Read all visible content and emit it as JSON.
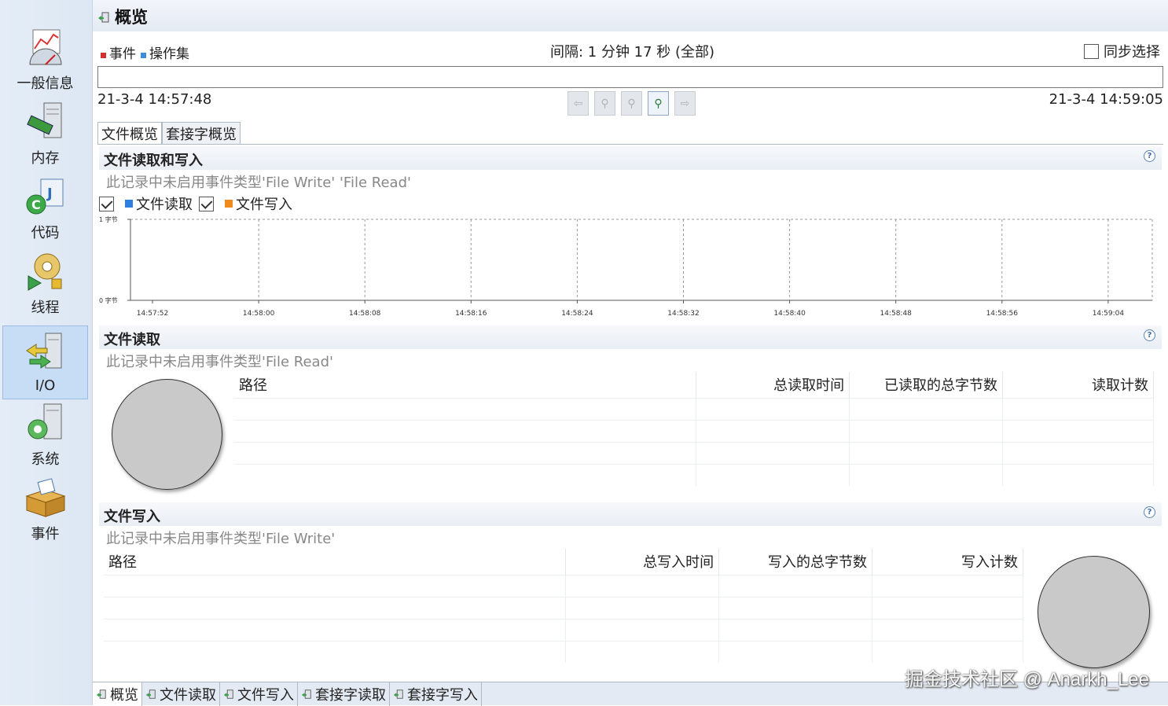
{
  "sidebar": {
    "items": [
      {
        "label": "一般信息",
        "icon": "dashboard-chart-icon"
      },
      {
        "label": "内存",
        "icon": "memory-server-icon"
      },
      {
        "label": "代码",
        "icon": "code-java-icon"
      },
      {
        "label": "线程",
        "icon": "thread-gear-icon"
      },
      {
        "label": "I/O",
        "icon": "io-server-arrows-icon",
        "active": true
      },
      {
        "label": "系统",
        "icon": "system-server-icon"
      },
      {
        "label": "事件",
        "icon": "events-box-icon"
      }
    ]
  },
  "header": {
    "title": "概览"
  },
  "legend": {
    "events": "事件",
    "operation_set": "操作集",
    "event_color": "#d32f2f",
    "opset_color": "#3b8fd9"
  },
  "interval": "间隔: 1 分钟 17 秒 (全部)",
  "sync_select": "同步选择",
  "time_range": {
    "start": "21-3-4 14:57:48",
    "end": "21-3-4 14:59:05"
  },
  "tabs": [
    {
      "label": "文件概览",
      "active": true
    },
    {
      "label": "套接字概览",
      "active": false
    }
  ],
  "section_rw": {
    "title": "文件读取和写入",
    "subtitle": "此记录中未启用事件类型'File Write' 'File Read'",
    "legend_read": "文件读取",
    "legend_write": "文件写入",
    "read_color": "#2e7fe0",
    "write_color": "#f08a1c"
  },
  "chart_data": {
    "type": "line",
    "ylim": [
      0,
      1
    ],
    "yticks": [
      "0 字节",
      "1 字节"
    ],
    "x": [
      "14:57:52",
      "14:58:00",
      "14:58:08",
      "14:58:16",
      "14:58:24",
      "14:58:32",
      "14:58:40",
      "14:58:48",
      "14:58:56",
      "14:59:04"
    ],
    "series": [
      {
        "name": "文件读取",
        "values": []
      },
      {
        "name": "文件写入",
        "values": []
      }
    ],
    "grid": true
  },
  "section_read": {
    "title": "文件读取",
    "subtitle": "此记录中未启用事件类型'File Read'",
    "columns": [
      "路径",
      "总读取时间",
      "已读取的总字节数",
      "读取计数"
    ]
  },
  "section_write": {
    "title": "文件写入",
    "subtitle": "此记录中未启用事件类型'File Write'",
    "columns": [
      "路径",
      "总写入时间",
      "写入的总字节数",
      "写入计数"
    ]
  },
  "bottom_tabs": [
    {
      "label": "概览",
      "active": true
    },
    {
      "label": "文件读取"
    },
    {
      "label": "文件写入"
    },
    {
      "label": "套接字读取"
    },
    {
      "label": "套接字写入"
    }
  ],
  "watermark": "掘金技术社区 @ Anarkh_Lee"
}
